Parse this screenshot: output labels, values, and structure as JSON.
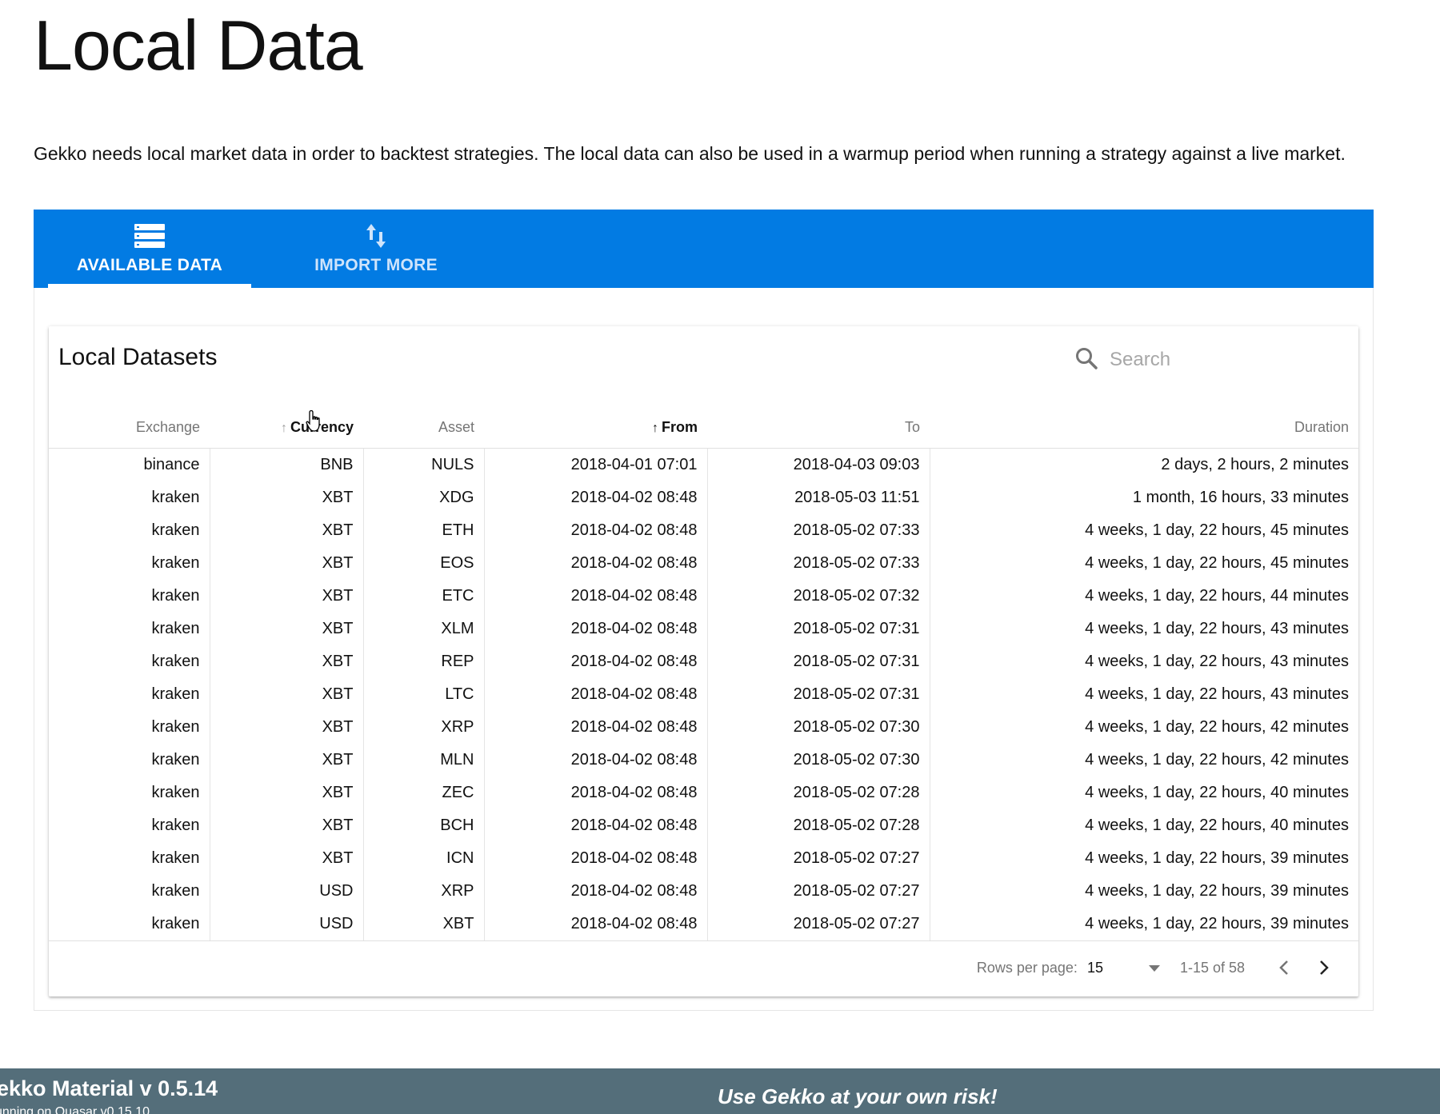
{
  "page": {
    "title": "Local Data",
    "intro": "Gekko needs local market data in order to backtest strategies. The local data can also be used in a warmup period when running a strategy against a live market."
  },
  "tabs": [
    {
      "label": "AVAILABLE DATA",
      "icon": "list-icon",
      "active": true
    },
    {
      "label": "IMPORT MORE",
      "icon": "import-export-icon",
      "active": false
    }
  ],
  "card": {
    "title": "Local Datasets",
    "search_placeholder": "Search"
  },
  "table": {
    "columns": [
      {
        "label": "Exchange",
        "sorted": false
      },
      {
        "label": "Currency",
        "sorted": true
      },
      {
        "label": "Asset",
        "sorted": false
      },
      {
        "label": "From",
        "sorted": true
      },
      {
        "label": "To",
        "sorted": false
      },
      {
        "label": "Duration",
        "sorted": false
      }
    ],
    "rows": [
      [
        "binance",
        "BNB",
        "NULS",
        "2018-04-01 07:01",
        "2018-04-03 09:03",
        "2 days, 2 hours, 2 minutes"
      ],
      [
        "kraken",
        "XBT",
        "XDG",
        "2018-04-02 08:48",
        "2018-05-03 11:51",
        "1 month, 16 hours, 33 minutes"
      ],
      [
        "kraken",
        "XBT",
        "ETH",
        "2018-04-02 08:48",
        "2018-05-02 07:33",
        "4 weeks, 1 day, 22 hours, 45 minutes"
      ],
      [
        "kraken",
        "XBT",
        "EOS",
        "2018-04-02 08:48",
        "2018-05-02 07:33",
        "4 weeks, 1 day, 22 hours, 45 minutes"
      ],
      [
        "kraken",
        "XBT",
        "ETC",
        "2018-04-02 08:48",
        "2018-05-02 07:32",
        "4 weeks, 1 day, 22 hours, 44 minutes"
      ],
      [
        "kraken",
        "XBT",
        "XLM",
        "2018-04-02 08:48",
        "2018-05-02 07:31",
        "4 weeks, 1 day, 22 hours, 43 minutes"
      ],
      [
        "kraken",
        "XBT",
        "REP",
        "2018-04-02 08:48",
        "2018-05-02 07:31",
        "4 weeks, 1 day, 22 hours, 43 minutes"
      ],
      [
        "kraken",
        "XBT",
        "LTC",
        "2018-04-02 08:48",
        "2018-05-02 07:31",
        "4 weeks, 1 day, 22 hours, 43 minutes"
      ],
      [
        "kraken",
        "XBT",
        "XRP",
        "2018-04-02 08:48",
        "2018-05-02 07:30",
        "4 weeks, 1 day, 22 hours, 42 minutes"
      ],
      [
        "kraken",
        "XBT",
        "MLN",
        "2018-04-02 08:48",
        "2018-05-02 07:30",
        "4 weeks, 1 day, 22 hours, 42 minutes"
      ],
      [
        "kraken",
        "XBT",
        "ZEC",
        "2018-04-02 08:48",
        "2018-05-02 07:28",
        "4 weeks, 1 day, 22 hours, 40 minutes"
      ],
      [
        "kraken",
        "XBT",
        "BCH",
        "2018-04-02 08:48",
        "2018-05-02 07:28",
        "4 weeks, 1 day, 22 hours, 40 minutes"
      ],
      [
        "kraken",
        "XBT",
        "ICN",
        "2018-04-02 08:48",
        "2018-05-02 07:27",
        "4 weeks, 1 day, 22 hours, 39 minutes"
      ],
      [
        "kraken",
        "USD",
        "XRP",
        "2018-04-02 08:48",
        "2018-05-02 07:27",
        "4 weeks, 1 day, 22 hours, 39 minutes"
      ],
      [
        "kraken",
        "USD",
        "XBT",
        "2018-04-02 08:48",
        "2018-05-02 07:27",
        "4 weeks, 1 day, 22 hours, 39 minutes"
      ]
    ]
  },
  "pagination": {
    "rows_per_page_label": "Rows per page:",
    "rows_per_page_value": "15",
    "range_text": "1-15 of 58"
  },
  "footer": {
    "title": "ekko Material v 0.5.14",
    "subtitle": "unning on Quasar v0.15.10",
    "warning": "Use Gekko at your own risk!"
  },
  "colors": {
    "primary": "#027be3",
    "footer_bg": "#546e7a"
  }
}
